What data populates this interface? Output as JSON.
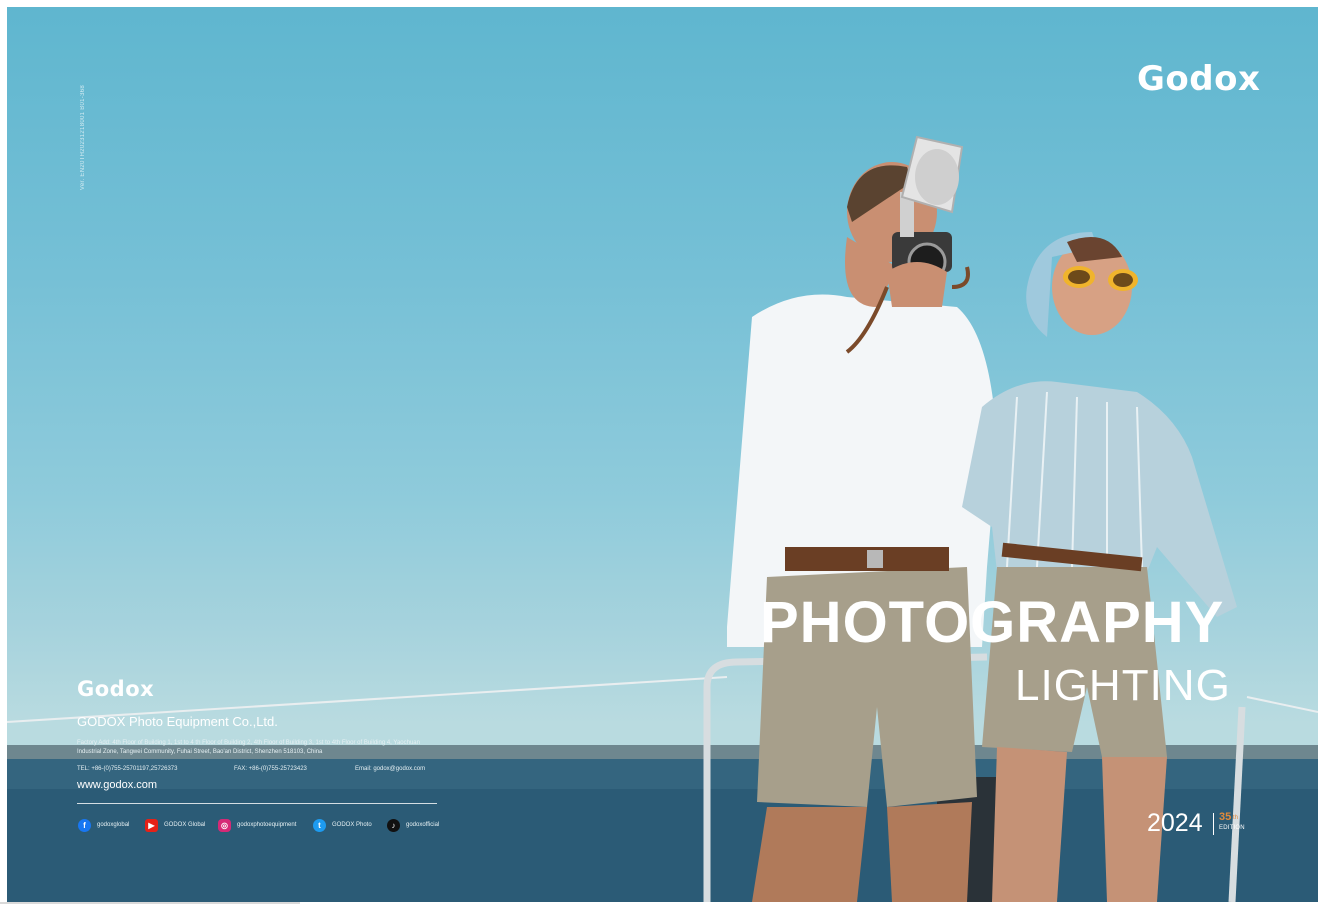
{
  "catalog": {
    "version_code": "Ver. EN20TH20231218001  B01-368",
    "brand_top": "Godox",
    "title": "PHOTOGRAPHY",
    "subtitle": "LIGHTING",
    "year": "2024",
    "edition_number": "35",
    "edition_suffix": "th",
    "edition_word": "EDITION"
  },
  "footer": {
    "brand": "Godox",
    "company": "GODOX Photo Equipment Co.,Ltd.",
    "address": "Factory Add: 4th Floor of Building 1, 1st to 4 th Floor of Building 2, 4th Floor of Building 3, 1st to 4th Floor of Building 4, Yaochuan Industrial Zone, Tangwei Community, Fuhai Street, Bao'an District, Shenzhen 518103, China",
    "tel": "TEL: +86-(0)755-25701197,25726373",
    "fax": "FAX: +86-(0)755-25723423",
    "email": "Email: godox@godox.com",
    "website": "www.godox.com",
    "social": [
      {
        "icon": "facebook-icon",
        "handle": "godoxglobal",
        "color": "#1877f2"
      },
      {
        "icon": "youtube-icon",
        "handle": "GODOX Global",
        "color": "#e62117"
      },
      {
        "icon": "instagram-icon",
        "handle": "godoxphotoequipment",
        "color": "#d62976"
      },
      {
        "icon": "twitter-icon",
        "handle": "GODOX Photo",
        "color": "#1d9bf0"
      },
      {
        "icon": "tiktok-icon",
        "handle": "godoxofficial",
        "color": "#111111"
      }
    ]
  },
  "colors": {
    "sky": "#6cbcd3",
    "sea": "#2a5b76",
    "edition_accent": "#e08a3a"
  }
}
